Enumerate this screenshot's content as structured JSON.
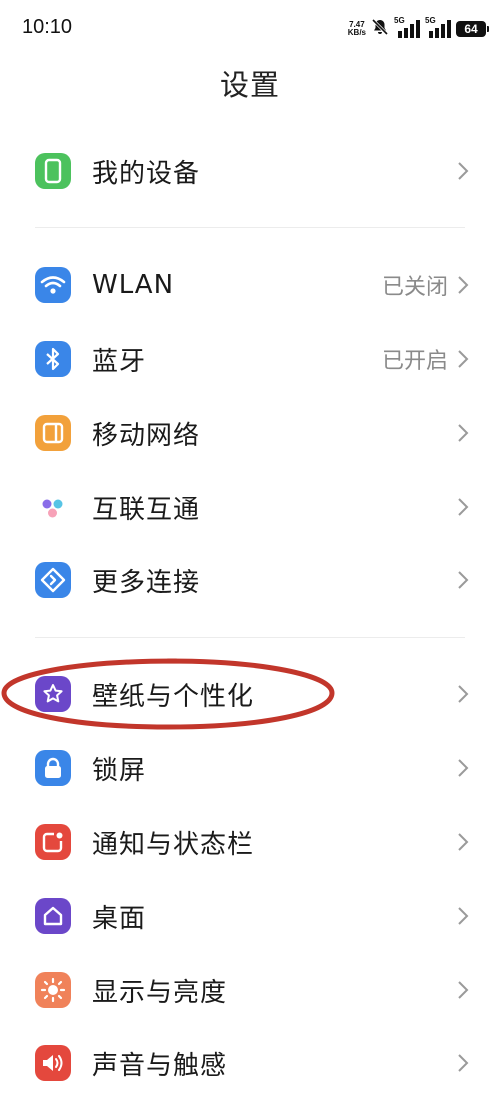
{
  "status_bar": {
    "time": "10:10",
    "net_speed_value": "7.47",
    "net_speed_unit": "KB/s",
    "sim1_gen": "5G",
    "sim2_gen": "5G",
    "battery": "64"
  },
  "title": "设置",
  "groups": [
    {
      "items": [
        {
          "label": "我的设备",
          "value": "",
          "icon": "device-icon",
          "color": "#4cc25d"
        }
      ]
    },
    {
      "items": [
        {
          "label": "WLAN",
          "value": "已关闭",
          "icon": "wifi-icon",
          "color": "#3a86e8"
        },
        {
          "label": "蓝牙",
          "value": "已开启",
          "icon": "bluetooth-icon",
          "color": "#3a86e8"
        },
        {
          "label": "移动网络",
          "value": "",
          "icon": "mobile-network-icon",
          "color": "#f2a13b"
        },
        {
          "label": "互联互通",
          "value": "",
          "icon": "interconnect-icon",
          "color": "#ffffff"
        },
        {
          "label": "更多连接",
          "value": "",
          "icon": "more-connections-icon",
          "color": "#3a86e8"
        }
      ]
    },
    {
      "items": [
        {
          "label": "壁纸与个性化",
          "value": "",
          "icon": "wallpaper-icon",
          "color": "#6b47c9"
        },
        {
          "label": "锁屏",
          "value": "",
          "icon": "lock-icon",
          "color": "#3a86e8"
        },
        {
          "label": "通知与状态栏",
          "value": "",
          "icon": "notification-icon",
          "color": "#e4483d"
        },
        {
          "label": "桌面",
          "value": "",
          "icon": "home-icon",
          "color": "#6b47c9"
        },
        {
          "label": "显示与亮度",
          "value": "",
          "icon": "display-icon",
          "color": "#f0825a"
        },
        {
          "label": "声音与触感",
          "value": "",
          "icon": "sound-icon",
          "color": "#e4483d"
        }
      ]
    }
  ],
  "annotation_color": "#c2362b"
}
